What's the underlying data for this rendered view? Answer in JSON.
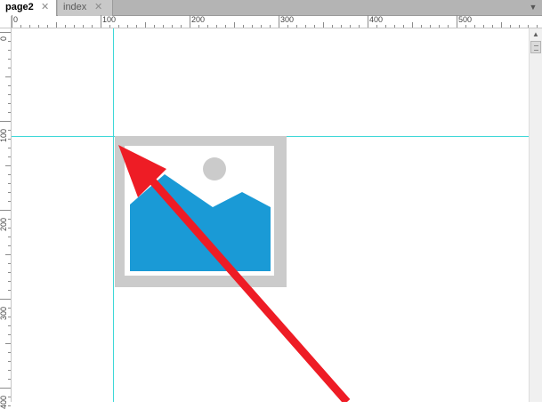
{
  "tabs": [
    {
      "label": "page2",
      "active": true
    },
    {
      "label": "index",
      "active": false
    }
  ],
  "close_glyph": "✕",
  "ruler": {
    "top_labels": [
      "0",
      "100",
      "200",
      "300",
      "400",
      "500"
    ],
    "left_labels": [
      "0",
      "100",
      "200",
      "300",
      "400"
    ]
  },
  "colors": {
    "guide": "#3fd8d8",
    "placeholder_frame": "#cbcbcb",
    "placeholder_mountain": "#1a9ad6",
    "placeholder_sun": "#cbcbcb",
    "arrow": "#ee1c25"
  },
  "icons": {
    "placeholder": "image-placeholder-icon",
    "arrow": "red-arrow-annotation"
  }
}
